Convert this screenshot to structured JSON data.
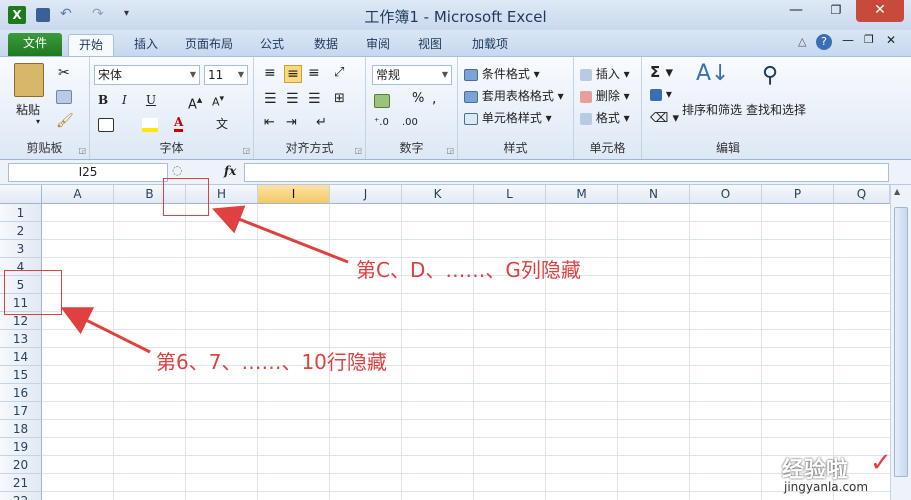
{
  "window": {
    "title": "工作簿1 - Microsoft Excel"
  },
  "tabs": [
    "文件",
    "开始",
    "插入",
    "页面布局",
    "公式",
    "数据",
    "审阅",
    "视图",
    "加载项"
  ],
  "ribbon": {
    "clipboard": {
      "paste": "粘贴",
      "label": "剪贴板"
    },
    "font": {
      "name": "宋体",
      "size": "11",
      "label": "字体"
    },
    "alignment": {
      "label": "对齐方式"
    },
    "number": {
      "format": "常规",
      "label": "数字"
    },
    "styles": {
      "conditional": "条件格式",
      "table": "套用表格格式",
      "cell": "单元格样式",
      "label": "样式"
    },
    "cells": {
      "insert": "插入",
      "delete": "删除",
      "format": "格式",
      "label": "单元格"
    },
    "editing": {
      "sort": "排序和筛选",
      "find": "查找和选择",
      "label": "编辑"
    }
  },
  "formula_bar": {
    "name_box": "I25",
    "fx": "fx"
  },
  "columns": [
    "A",
    "B",
    "H",
    "I",
    "J",
    "K",
    "L",
    "M",
    "N",
    "O",
    "P",
    "Q"
  ],
  "rows": [
    "1",
    "2",
    "3",
    "4",
    "5",
    "11",
    "12",
    "13",
    "14",
    "15",
    "16",
    "17",
    "18",
    "19",
    "20",
    "21",
    "22"
  ],
  "annotations": {
    "cols": "第C、D、……、G列隐藏",
    "rows": "第6、7、……、10行隐藏"
  },
  "watermark": {
    "main": "经验啦",
    "url": "jingyanla.com"
  },
  "colors": {
    "accent": "#1f7a1f",
    "annotation": "#e04040"
  }
}
